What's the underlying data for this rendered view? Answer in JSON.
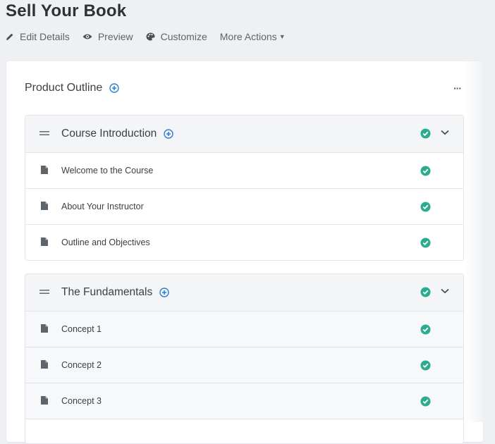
{
  "page": {
    "title": "Sell Your Book"
  },
  "toolbar": {
    "edit_label": "Edit Details",
    "preview_label": "Preview",
    "customize_label": "Customize",
    "more_label": "More Actions"
  },
  "outline": {
    "title": "Product Outline",
    "more_menu": "···"
  },
  "sections": [
    {
      "title": "Course Introduction",
      "lessons": [
        {
          "label": "Welcome to the Course"
        },
        {
          "label": "About Your Instructor"
        },
        {
          "label": "Outline and Objectives"
        }
      ]
    },
    {
      "title": "The Fundamentals",
      "lessons": [
        {
          "label": "Concept 1"
        },
        {
          "label": "Concept 2"
        },
        {
          "label": "Concept 3"
        }
      ]
    }
  ],
  "colors": {
    "accent": "#2d7fd3",
    "check": "#2bab8f"
  },
  "icons": {
    "edit": "pencil-icon",
    "preview": "eye-icon",
    "customize": "palette-icon",
    "add": "plus-circle-icon",
    "drag": "drag-handle-icon",
    "lesson": "document-icon",
    "status": "check-circle-icon",
    "collapse": "chevron-down-icon"
  }
}
